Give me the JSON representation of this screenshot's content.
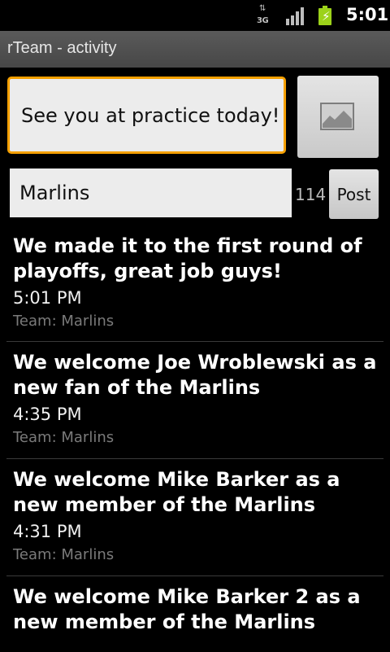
{
  "status_bar": {
    "network_label": "3G",
    "clock": "5:01",
    "icons": [
      "3g-data-icon",
      "signal-icon",
      "battery-charging-icon"
    ],
    "battery_color": "#9cd21a"
  },
  "window": {
    "title": "rTeam - activity"
  },
  "composer": {
    "message_value": "See you at practice today!",
    "team_value": "Marlins",
    "char_count": "114",
    "post_label": "Post",
    "accent_color": "#f5a000"
  },
  "feed": {
    "items": [
      {
        "text": "We made it to the first round of playoffs, great job guys!",
        "time": "5:01 PM",
        "team": "Team: Marlins"
      },
      {
        "text": "We welcome Joe Wroblewski as a new fan of the Marlins",
        "time": "4:35 PM",
        "team": "Team: Marlins"
      },
      {
        "text": "We welcome Mike Barker as a new member of the Marlins",
        "time": "4:31 PM",
        "team": "Team: Marlins"
      },
      {
        "text": "We welcome Mike Barker 2 as a new member of the Marlins"
      }
    ]
  }
}
